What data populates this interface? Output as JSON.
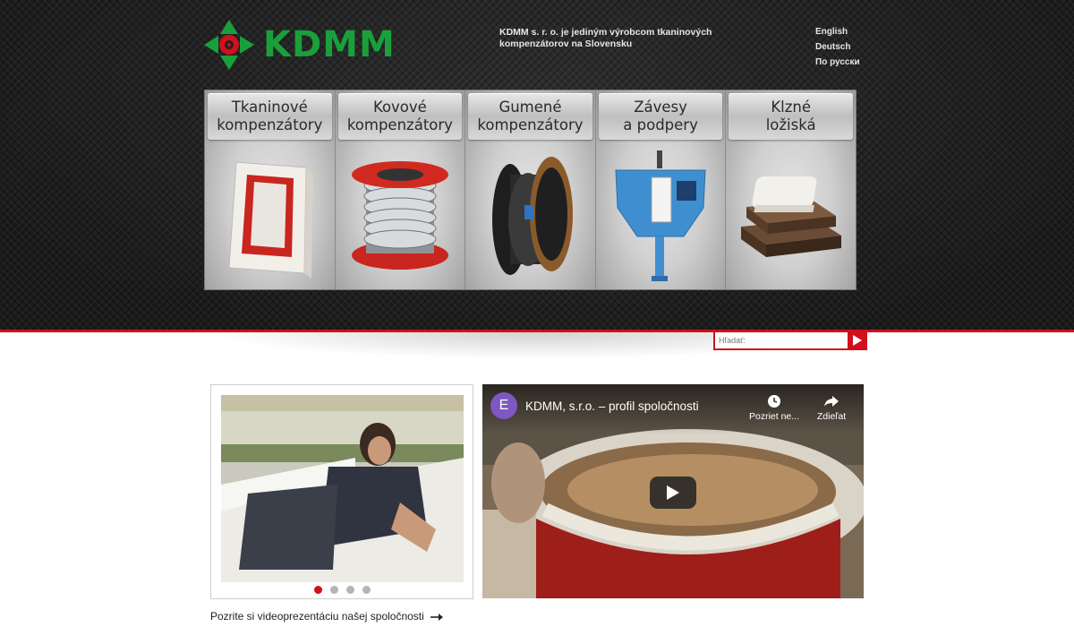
{
  "brand": {
    "name": "KDMM",
    "green": "#1aa03a",
    "red": "#d0101a"
  },
  "header": {
    "tagline": "KDMM s. r. o. je jediným výrobcom tkaninových kompenzátorov na Slovensku",
    "languages": [
      "English",
      "Deutsch",
      "По русски"
    ]
  },
  "products": [
    {
      "line1": "Tkaninové",
      "line2": "kompenzátory",
      "icon": "fabric-compensator-image"
    },
    {
      "line1": "Kovové",
      "line2": "kompenzátory",
      "icon": "metal-bellows-image"
    },
    {
      "line1": "Gumené",
      "line2": "kompenzátory",
      "icon": "rubber-compensator-image"
    },
    {
      "line1": "Závesy",
      "line2": "a podpery",
      "icon": "spring-hanger-image"
    },
    {
      "line1": "Klzné",
      "line2": "ložiská",
      "icon": "sliding-bearing-image"
    }
  ],
  "search": {
    "placeholder": "Hľadať:"
  },
  "gallery": {
    "slides": 4,
    "active_index": 0
  },
  "video": {
    "channel_initial": "E",
    "title": "KDMM, s.r.o. – profil spoločnosti",
    "watch_later": "Pozriet ne...",
    "share": "Zdieľat"
  },
  "caption": "Pozrite si videoprezentáciu našej spoločnosti"
}
